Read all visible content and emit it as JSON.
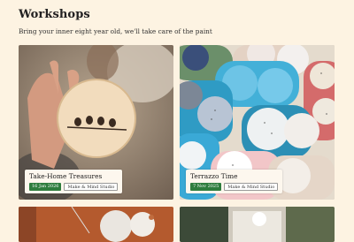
{
  "page": {
    "title": "Workshops",
    "subtitle": "Bring your inner eight year old, we'll take care of the paint"
  },
  "cards": [
    {
      "title": "Take-Home Treasures",
      "date": "16 Jan 2026",
      "studio": "Make & Mind Studio",
      "image_icon": "ornament-with-birds-image"
    },
    {
      "title": "Terrazzo Time",
      "date": "7 Nov 2025",
      "studio": "Make & Mind Studio",
      "image_icon": "terrazzo-coasters-image"
    },
    {
      "title": "",
      "image_icon": "clay-ornaments-image"
    },
    {
      "title": "",
      "image_icon": "plaster-pots-image"
    }
  ],
  "colors": {
    "background": "#fdf3e2",
    "date_badge": "#2e7d3e",
    "label_background": "#fdf7ee"
  }
}
